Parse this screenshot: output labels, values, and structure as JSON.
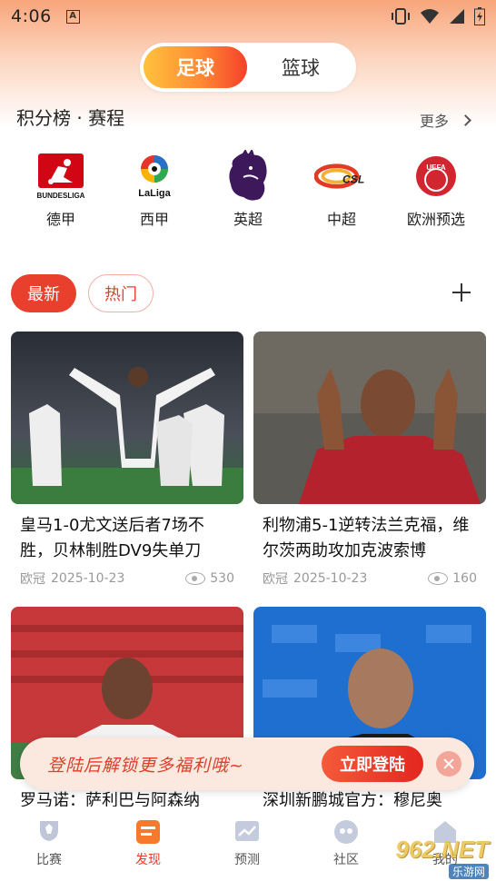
{
  "status_bar": {
    "time": "4:06",
    "notification_glyph": "A"
  },
  "tabs": [
    {
      "label": "足球",
      "active": true
    },
    {
      "label": "篮球",
      "active": false
    }
  ],
  "standings": {
    "title": "积分榜 · 赛程",
    "more_label": "更多",
    "leagues": [
      {
        "name": "德甲",
        "icon": "bundesliga-logo",
        "logo_text": "BUNDESLIGA"
      },
      {
        "name": "西甲",
        "icon": "laliga-logo",
        "logo_text": "LaLiga"
      },
      {
        "name": "英超",
        "icon": "premier-league-logo"
      },
      {
        "name": "中超",
        "icon": "csl-logo",
        "logo_text": "CSL"
      },
      {
        "name": "欧洲预选",
        "icon": "uefa-logo",
        "logo_text": "UEFA"
      }
    ]
  },
  "filters": [
    {
      "label": "最新",
      "active": true
    },
    {
      "label": "热门",
      "active": false
    }
  ],
  "news": [
    {
      "title": "皇马1-0尤文送后者7场不胜，贝林制胜DV9失单刀",
      "tag": "欧冠",
      "date": "2025-10-23",
      "views": "530"
    },
    {
      "title": "利物浦5-1逆转法兰克福，维尔茨两助攻加克波索博",
      "tag": "欧冠",
      "date": "2025-10-23",
      "views": "160"
    },
    {
      "title": "罗马诺：萨利巴与阿森纳",
      "tag": "",
      "date": "",
      "views": ""
    },
    {
      "title": "深圳新鹏城官方：穆尼奥",
      "tag": "",
      "date": "",
      "views": ""
    }
  ],
  "login_banner": {
    "text": "登陆后解锁更多福利哦~",
    "button_label": "立即登陆"
  },
  "bottom_nav": [
    {
      "label": "比赛",
      "icon": "trophy-icon",
      "active": false
    },
    {
      "label": "发现",
      "icon": "discover-icon",
      "active": true
    },
    {
      "label": "预测",
      "icon": "chart-icon",
      "active": false
    },
    {
      "label": "社区",
      "icon": "community-icon",
      "active": false
    },
    {
      "label": "我的",
      "icon": "home-icon",
      "active": false
    }
  ],
  "watermark": {
    "brand": "962.NET",
    "sub": "乐游网"
  },
  "colors": {
    "accent": "#e8402c",
    "tab_gradient_start": "#ffc23d",
    "tab_gradient_end": "#f4412a"
  }
}
